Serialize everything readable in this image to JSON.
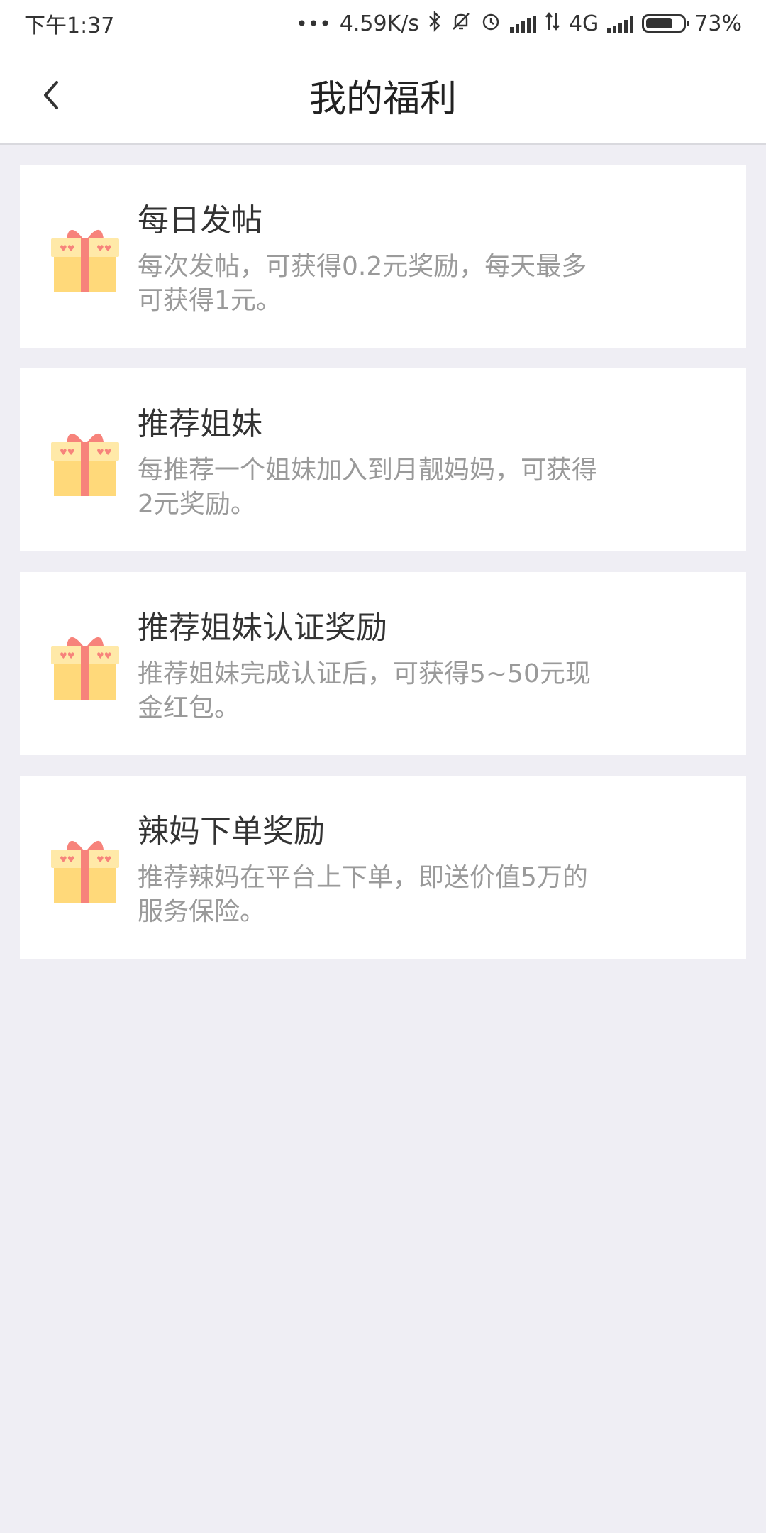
{
  "status_bar": {
    "time": "下午1:37",
    "net_speed": "4.59K/s",
    "network_type": "4G",
    "battery_percent": "73%",
    "battery_level": 0.73,
    "icons": [
      "dots-icon",
      "bluetooth-icon",
      "mute-icon",
      "alarm-icon",
      "hd-signal-icon",
      "data-arrows-icon",
      "signal-icon",
      "battery-icon"
    ]
  },
  "header": {
    "back_icon": "chevron-left-icon",
    "title": "我的福利"
  },
  "benefits": [
    {
      "icon": "gift-icon",
      "title": "每日发帖",
      "description": "每次发帖，可获得0.2元奖励，每天最多可获得1元。"
    },
    {
      "icon": "gift-icon",
      "title": "推荐姐妹",
      "description": "每推荐一个姐妹加入到月靓妈妈，可获得2元奖励。"
    },
    {
      "icon": "gift-icon",
      "title": "推荐姐妹认证奖励",
      "description": "推荐姐妹完成认证后，可获得5~50元现金红包。"
    },
    {
      "icon": "gift-icon",
      "title": "辣妈下单奖励",
      "description": "推荐辣妈在平台上下单，即送价值5万的服务保险。"
    }
  ],
  "colors": {
    "background": "#efeef4",
    "card": "#ffffff",
    "title_text": "#333333",
    "desc_text": "#9a9a9a",
    "gift_box": "#ffd97a",
    "gift_ribbon": "#f7837b"
  }
}
